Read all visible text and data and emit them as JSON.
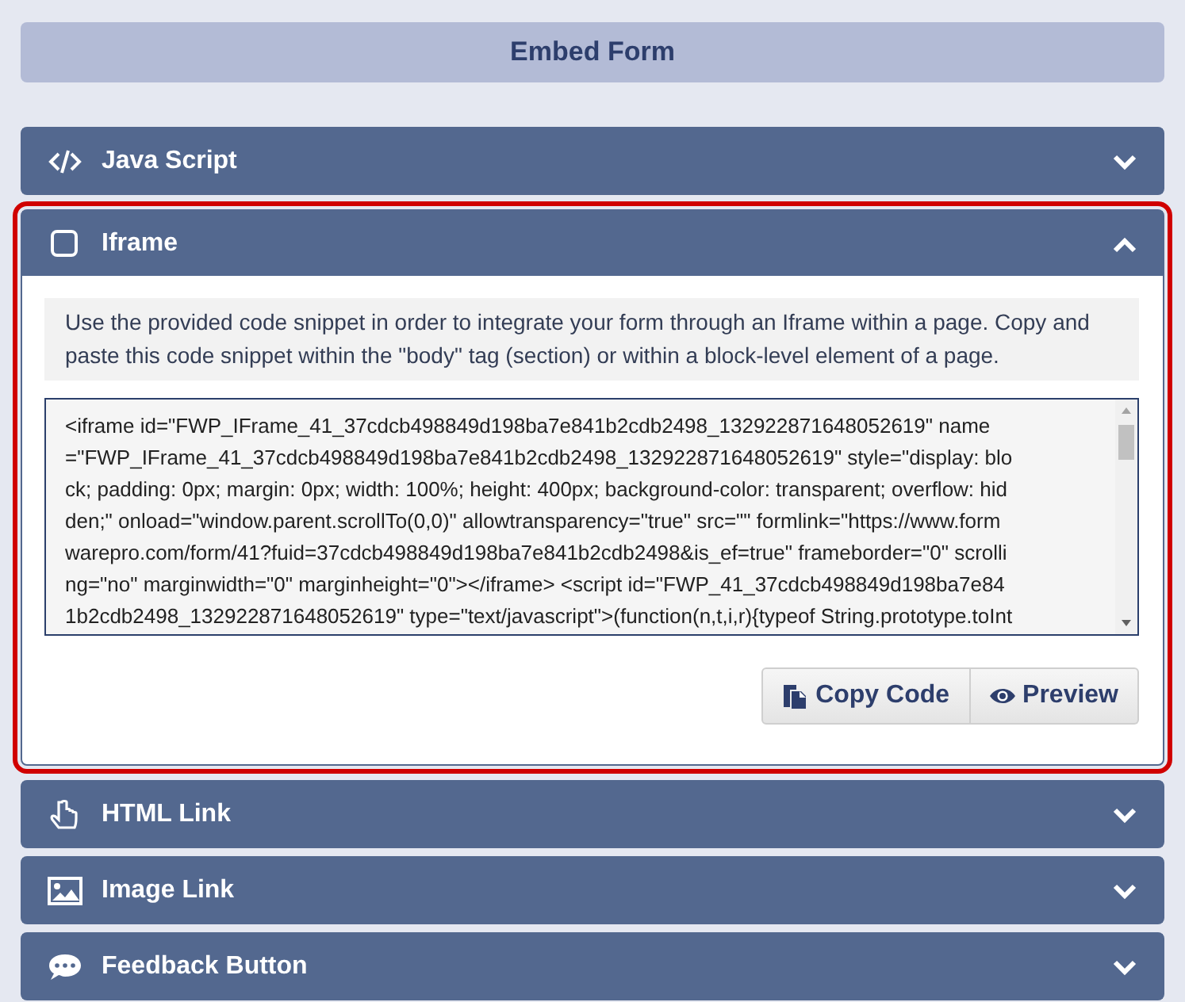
{
  "title": "Embed Form",
  "sections": [
    {
      "kind": "code",
      "label": "Java Script",
      "expanded": false,
      "highlighted": false
    },
    {
      "kind": "checkbox",
      "label": "Iframe",
      "expanded": true,
      "highlighted": true,
      "description": "Use the provided code snippet in order to integrate your form through an Iframe within a page. Copy and paste this code snippet within the \"body\" tag (section) or within a block-level element of a page.",
      "code_lines": [
        "<iframe id=\"FWP_IFrame_41_37cdcb498849d198ba7e841b2cdb2498_132922871648052619\" name",
        "=\"FWP_IFrame_41_37cdcb498849d198ba7e841b2cdb2498_132922871648052619\" style=\"display: blo",
        "ck; padding: 0px; margin: 0px; width: 100%; height: 400px; background-color: transparent; overflow: hid",
        "den;\" onload=\"window.parent.scrollTo(0,0)\" allowtransparency=\"true\" src=\"\" formlink=\"https://www.form",
        "warepro.com/form/41?fuid=37cdcb498849d198ba7e841b2cdb2498&is_ef=true\" frameborder=\"0\" scrolli",
        "ng=\"no\" marginwidth=\"0\" marginheight=\"0\"></iframe> <script id=\"FWP_41_37cdcb498849d198ba7e84",
        "1b2cdb2498_132922871648052619\" type=\"text/javascript\">(function(n,t,i,r){typeof String.prototype.toInt"
      ],
      "buttons": [
        {
          "kind": "copy",
          "label": "Copy Code"
        },
        {
          "kind": "preview",
          "label": "Preview"
        }
      ]
    },
    {
      "kind": "hand",
      "label": "HTML Link",
      "expanded": false,
      "highlighted": false
    },
    {
      "kind": "image",
      "label": "Image Link",
      "expanded": false,
      "highlighted": false
    },
    {
      "kind": "comment",
      "label": "Feedback Button",
      "expanded": false,
      "highlighted": false
    }
  ]
}
